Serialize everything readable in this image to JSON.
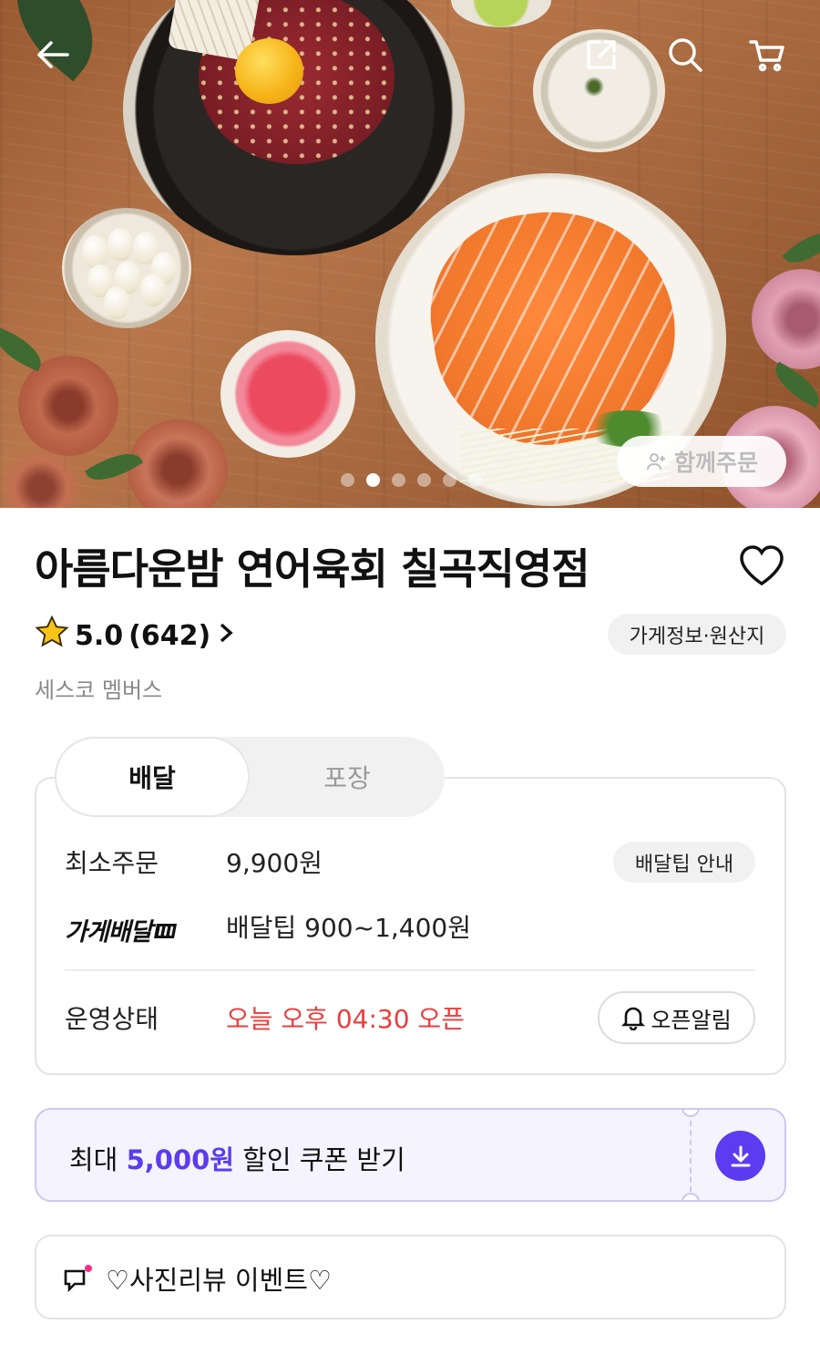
{
  "header": {
    "back_icon": "arrow-left-icon",
    "share_icon": "share-external-icon",
    "search_icon": "search-icon",
    "cart_icon": "cart-icon",
    "carousel": {
      "total": 6,
      "active_index": 1
    },
    "group_order_label": "함께주문"
  },
  "store": {
    "name": "아름다운밤 연어육회 칠곡직영점",
    "rating": "5.0",
    "review_count": "(642)",
    "info_button": "가게정보·원산지",
    "membership": "세스코 멤버스"
  },
  "order_tabs": [
    {
      "label": "배달",
      "selected": true
    },
    {
      "label": "포장",
      "selected": false
    }
  ],
  "delivery": {
    "min_order_label": "최소주문",
    "min_order_value": "9,900원",
    "tip_info_button": "배달팁 안내",
    "store_delivery_label": "가게배달",
    "tip_value": "배달팁 900~1,400원",
    "status_label": "운영상태",
    "status_value": "오늘 오후 04:30 오픈",
    "alarm_button": "오픈알림"
  },
  "coupon": {
    "prefix": "최대 ",
    "amount": "5,000원",
    "suffix": " 할인 쿠폰 받기"
  },
  "event": {
    "label": "♡사진리뷰 이벤트♡"
  },
  "colors": {
    "accent_purple": "#5b3cf0",
    "open_red": "#ec3d3d",
    "coupon_bg": "#f5f3fe"
  }
}
